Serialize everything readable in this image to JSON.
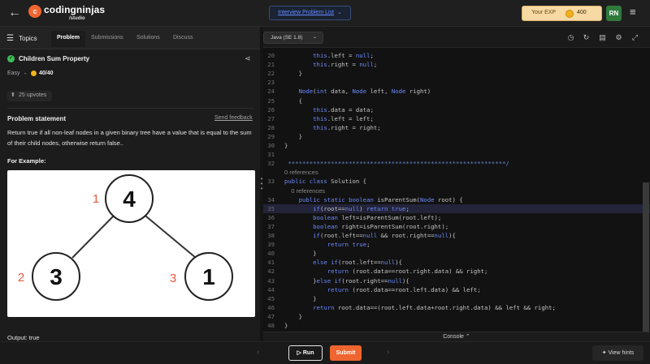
{
  "header": {
    "brand": "codingninjas",
    "brand_sub": "/studio",
    "logo_letter": "c",
    "problem_list": "Interview Problem List",
    "exp_label": "Your EXP",
    "exp_value": "400",
    "avatar": "RN"
  },
  "left_tabs": {
    "topics": "Topics",
    "items": [
      "Problem",
      "Submissions",
      "Solutions",
      "Discuss"
    ]
  },
  "problem": {
    "title": "Children Sum Property",
    "difficulty": "Easy",
    "solved": "40/40",
    "upvotes": "25 upvotes",
    "statement_title": "Problem statement",
    "feedback": "Send feedback",
    "statement": "Return true if all non-leaf nodes in a given binary tree have a value that is equal to the sum of their child nodes, otherwise return false..",
    "example_title": "For Example:",
    "output": "Output: true"
  },
  "tree_example": {
    "nodes": [
      {
        "value": "4",
        "label": "1"
      },
      {
        "value": "3",
        "label": "2"
      },
      {
        "value": "1",
        "label": "3"
      }
    ],
    "label_color": "#e8583f"
  },
  "editor": {
    "language": "Java (SE 1.8)",
    "console": "Console",
    "code_lines": [
      {
        "n": "20",
        "t": "        this.left = null;"
      },
      {
        "n": "21",
        "t": "        this.right = null;"
      },
      {
        "n": "22",
        "t": "    }"
      },
      {
        "n": "23",
        "t": ""
      },
      {
        "n": "24",
        "t": "    Node(int data, Node left, Node right)"
      },
      {
        "n": "25",
        "t": "    {"
      },
      {
        "n": "26",
        "t": "        this.data = data;"
      },
      {
        "n": "27",
        "t": "        this.left = left;"
      },
      {
        "n": "28",
        "t": "        this.right = right;"
      },
      {
        "n": "29",
        "t": "    }"
      },
      {
        "n": "30",
        "t": "}"
      },
      {
        "n": "31",
        "t": ""
      },
      {
        "n": "32",
        "t": " *************************************************************/"
      },
      {
        "n": "",
        "t": "0 references"
      },
      {
        "n": "33",
        "t": "public class Solution {"
      },
      {
        "n": "",
        "t": "    0 references"
      },
      {
        "n": "34",
        "t": "    public static boolean isParentSum(Node root) {"
      },
      {
        "n": "35",
        "t": "        if(root==null) return true;"
      },
      {
        "n": "36",
        "t": "        boolean left=isParentSum(root.left);"
      },
      {
        "n": "37",
        "t": "        boolean right=isParentSum(root.right);"
      },
      {
        "n": "38",
        "t": "        if(root.left==null && root.right==null){"
      },
      {
        "n": "39",
        "t": "            return true;"
      },
      {
        "n": "40",
        "t": "        }"
      },
      {
        "n": "41",
        "t": "        else if(root.left==null){"
      },
      {
        "n": "42",
        "t": "            return (root.data==root.right.data) && right;"
      },
      {
        "n": "43",
        "t": "        }else if(root.right==null){"
      },
      {
        "n": "44",
        "t": "            return (root.data==root.left.data) && left;"
      },
      {
        "n": "45",
        "t": "        }"
      },
      {
        "n": "46",
        "t": "        return root.data==(root.left.data+root.right.data) && left && right;"
      },
      {
        "n": "47",
        "t": "    }"
      },
      {
        "n": "48",
        "t": "}"
      }
    ],
    "highlight_line": "35"
  },
  "footer": {
    "run": "Run",
    "submit": "Submit",
    "hints": "View hints"
  },
  "colors": {
    "accent": "#f0652f",
    "keyword": "#6c8cff",
    "link": "#5f8cff"
  }
}
